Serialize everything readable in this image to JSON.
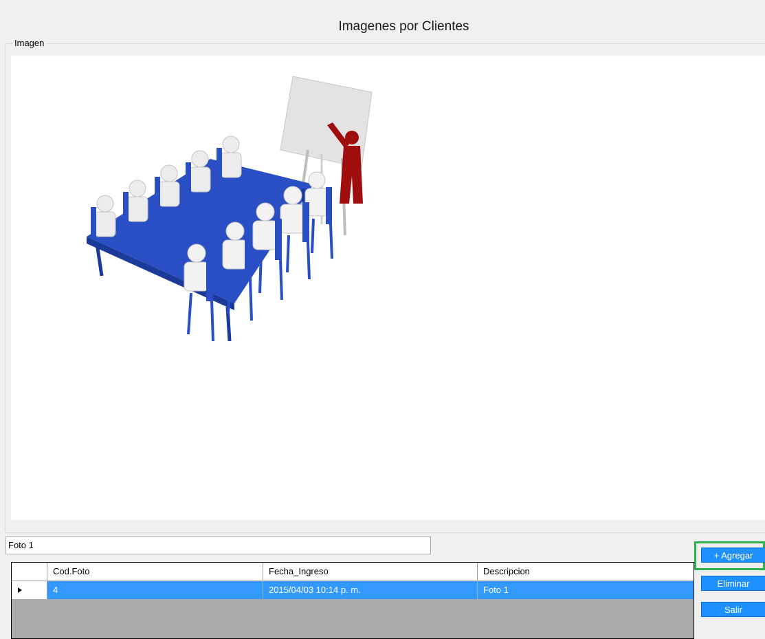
{
  "window": {
    "title": "Imagenes por Clientes"
  },
  "image_group": {
    "legend": "Imagen"
  },
  "description_input": {
    "value": "Foto 1"
  },
  "grid": {
    "columns": [
      "Cod.Foto",
      "Fecha_Ingreso",
      "Descripcion"
    ],
    "rows": [
      {
        "cod_foto": "4",
        "fecha_ingreso": "2015/04/03 10:14 p. m.",
        "descripcion": "Foto 1"
      }
    ]
  },
  "buttons": {
    "add": "+ Agregar",
    "delete": "Eliminar",
    "exit": "Salir"
  },
  "colors": {
    "selection": "#3399ff",
    "button": "#1e90ff",
    "highlight": "#2bb14a",
    "table": "#2a4fc4",
    "presenter": "#a00d0d"
  }
}
